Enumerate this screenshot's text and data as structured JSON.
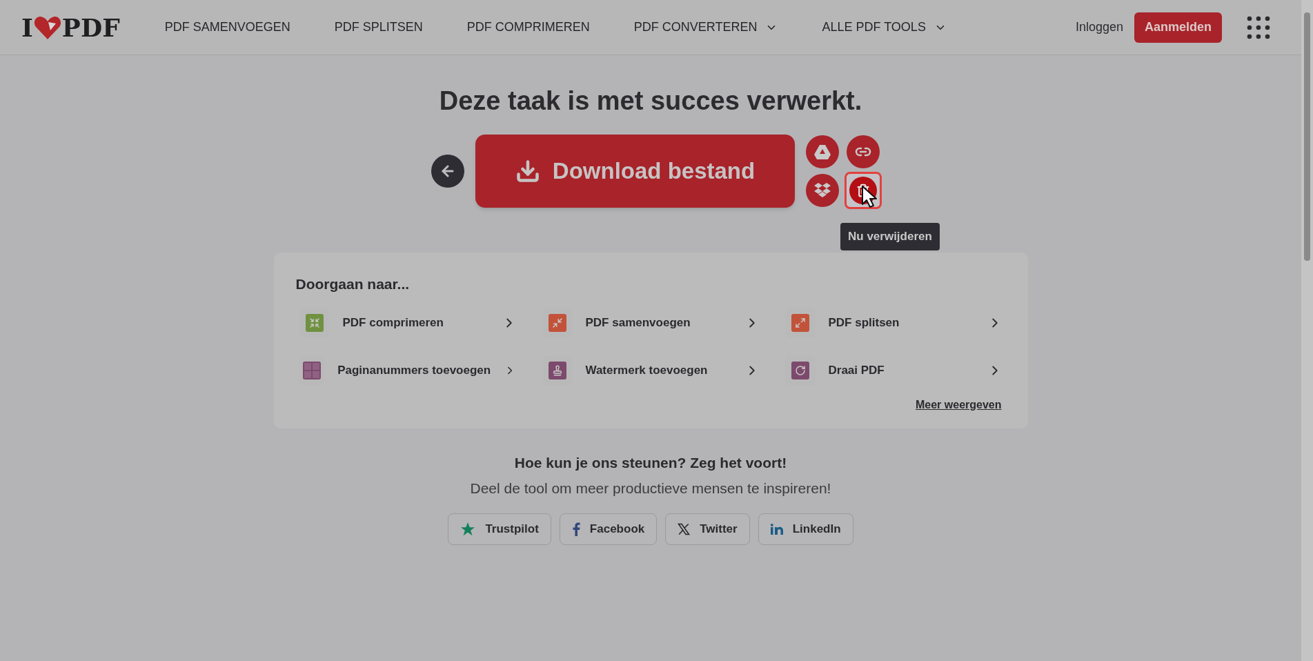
{
  "header": {
    "logo": {
      "left": "I",
      "right": "PDF"
    },
    "nav": [
      {
        "label": "PDF SAMENVOEGEN",
        "dropdown": false
      },
      {
        "label": "PDF SPLITSEN",
        "dropdown": false
      },
      {
        "label": "PDF COMPRIMEREN",
        "dropdown": false
      },
      {
        "label": "PDF CONVERTEREN",
        "dropdown": true
      },
      {
        "label": "ALLE PDF TOOLS",
        "dropdown": true
      }
    ],
    "login": "Inloggen",
    "signup": "Aanmelden"
  },
  "result": {
    "title": "Deze taak is met succes verwerkt.",
    "download": "Download bestand",
    "tooltip": "Nu verwijderen"
  },
  "continue": {
    "heading": "Doorgaan naar...",
    "tools": [
      {
        "label": "PDF comprimeren",
        "color": "#6f9140"
      },
      {
        "label": "PDF samenvoegen",
        "color": "#c2533a"
      },
      {
        "label": "PDF splitsen",
        "color": "#c2533a"
      },
      {
        "label": "Paginanummers toevoegen",
        "color": "#7c4a6c"
      },
      {
        "label": "Watermerk toevoegen",
        "color": "#7c4a6c"
      },
      {
        "label": "Draai PDF",
        "color": "#7c4a6c"
      }
    ],
    "more": "Meer weergeven"
  },
  "share": {
    "heading": "Hoe kun je ons steunen? Zeg het voort!",
    "subtitle": "Deel de tool om meer productieve mensen te inspireren!",
    "buttons": [
      {
        "label": "Trustpilot"
      },
      {
        "label": "Facebook"
      },
      {
        "label": "Twitter"
      },
      {
        "label": "LinkedIn"
      }
    ]
  }
}
